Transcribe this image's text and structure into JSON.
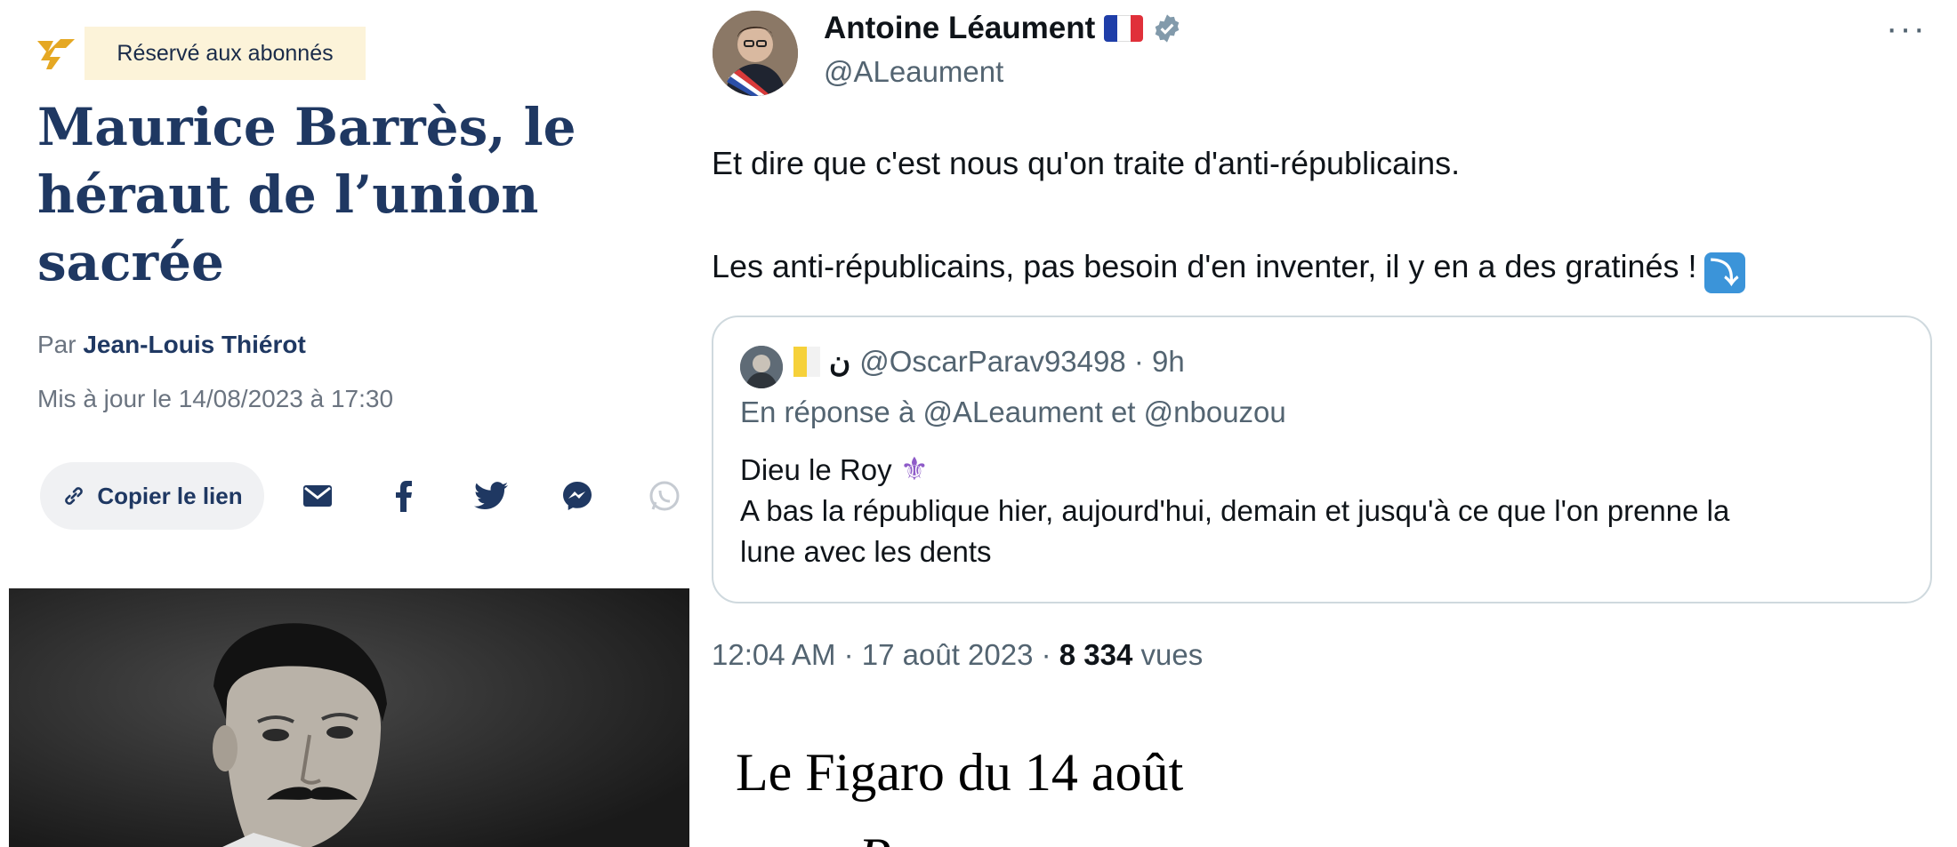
{
  "article": {
    "badge": "Réservé aux abonnés",
    "headline_lines": [
      "Maurice Barrès, le",
      "héraut de l’union",
      "sacrée"
    ],
    "byline_prefix": "Par ",
    "author": "Jean-Louis Thiérot",
    "updated": "Mis à jour le 14/08/2023 à 17:30",
    "copy_link": "Copier le lien",
    "share_icons": [
      "mail-icon",
      "facebook-icon",
      "twitter-icon",
      "messenger-icon",
      "whatsapp-icon"
    ],
    "accent_color": "#1f3862",
    "badge_color": "#fcf3d9"
  },
  "tweet": {
    "author": "Antoine Léaument",
    "handle": "@ALeaument",
    "more": "···",
    "text_line1": "Et dire que c'est nous qu'on traite d'anti-républicains.",
    "text_line2": "Les anti-républicains, pas besoin d'en inventer, il y en a des gratinés !",
    "arrow_emoji": "⤵",
    "quoted": {
      "name": "ن",
      "handle_time": "@OscarParav93498 · 9h",
      "reply_prefix": "En réponse à ",
      "reply_mention1": "@ALeaument",
      "reply_and": " et ",
      "reply_mention2": "@nbouzou",
      "line1": "Dieu le Roy",
      "line1_emoji": "⚜",
      "line2": "A bas la république hier, aujourd'hui, demain et jusqu'à ce que l'on prenne la",
      "line3": "lune avec les dents"
    },
    "time_date": "12:04 AM · 17 août 2023 · ",
    "views_count": "8 334",
    "views_label": " vues",
    "verified_color": "#829aab"
  },
  "caption": {
    "line1": "Le Figaro du 14 août",
    "line2": "Par...  …"
  }
}
